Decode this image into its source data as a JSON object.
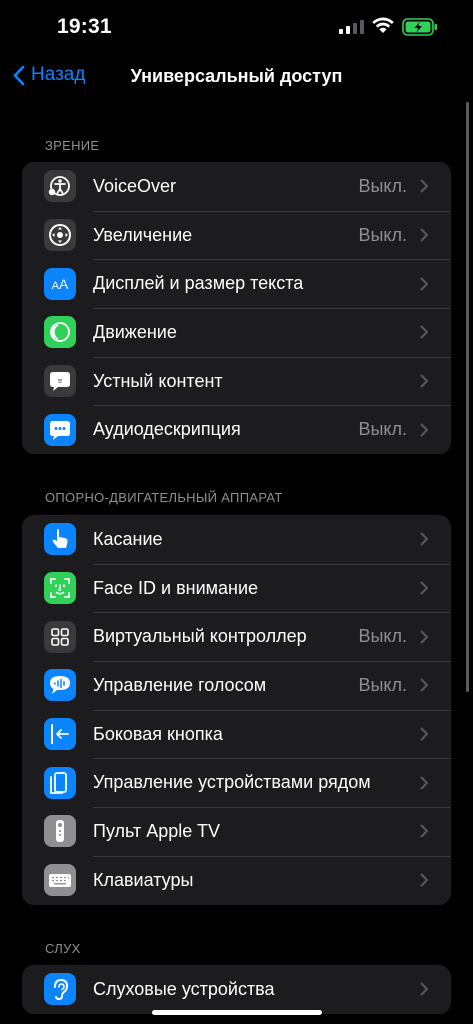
{
  "status": {
    "time": "19:31"
  },
  "nav": {
    "back_label": "Назад",
    "title": "Универсальный доступ"
  },
  "sections": [
    {
      "header": "ЗРЕНИЕ",
      "items": [
        {
          "label": "VoiceOver",
          "value": "Выкл.",
          "icon": "voiceover-icon",
          "color": "#3a3a3c"
        },
        {
          "label": "Увеличение",
          "value": "Выкл.",
          "icon": "zoom-icon",
          "color": "#3a3a3c"
        },
        {
          "label": "Дисплей и размер текста",
          "value": "",
          "icon": "text-size-icon",
          "color": "#0a84ff"
        },
        {
          "label": "Движение",
          "value": "",
          "icon": "motion-icon",
          "color": "#30d158"
        },
        {
          "label": "Устный контент",
          "value": "",
          "icon": "spoken-content-icon",
          "color": "#3a3a3c"
        },
        {
          "label": "Аудиодескрипция",
          "value": "Выкл.",
          "icon": "audio-description-icon",
          "color": "#0a84ff"
        }
      ]
    },
    {
      "header": "ОПОРНО-ДВИГАТЕЛЬНЫЙ АППАРАТ",
      "items": [
        {
          "label": "Касание",
          "value": "",
          "icon": "touch-icon",
          "color": "#0a84ff"
        },
        {
          "label": "Face ID и внимание",
          "value": "",
          "icon": "face-id-icon",
          "color": "#30d158"
        },
        {
          "label": "Виртуальный контроллер",
          "value": "Выкл.",
          "icon": "switch-control-icon",
          "color": "#3a3a3c"
        },
        {
          "label": "Управление голосом",
          "value": "Выкл.",
          "icon": "voice-control-icon",
          "color": "#0a84ff"
        },
        {
          "label": "Боковая кнопка",
          "value": "",
          "icon": "side-button-icon",
          "color": "#0a84ff"
        },
        {
          "label": "Управление устройствами рядом",
          "value": "",
          "icon": "nearby-devices-icon",
          "color": "#0a84ff"
        },
        {
          "label": "Пульт Apple TV",
          "value": "",
          "icon": "apple-tv-remote-icon",
          "color": "#8e8e93"
        },
        {
          "label": "Клавиатуры",
          "value": "",
          "icon": "keyboard-icon",
          "color": "#8e8e93"
        }
      ]
    },
    {
      "header": "СЛУХ",
      "items": [
        {
          "label": "Слуховые устройства",
          "value": "",
          "icon": "hearing-devices-icon",
          "color": "#0a84ff"
        }
      ]
    }
  ]
}
